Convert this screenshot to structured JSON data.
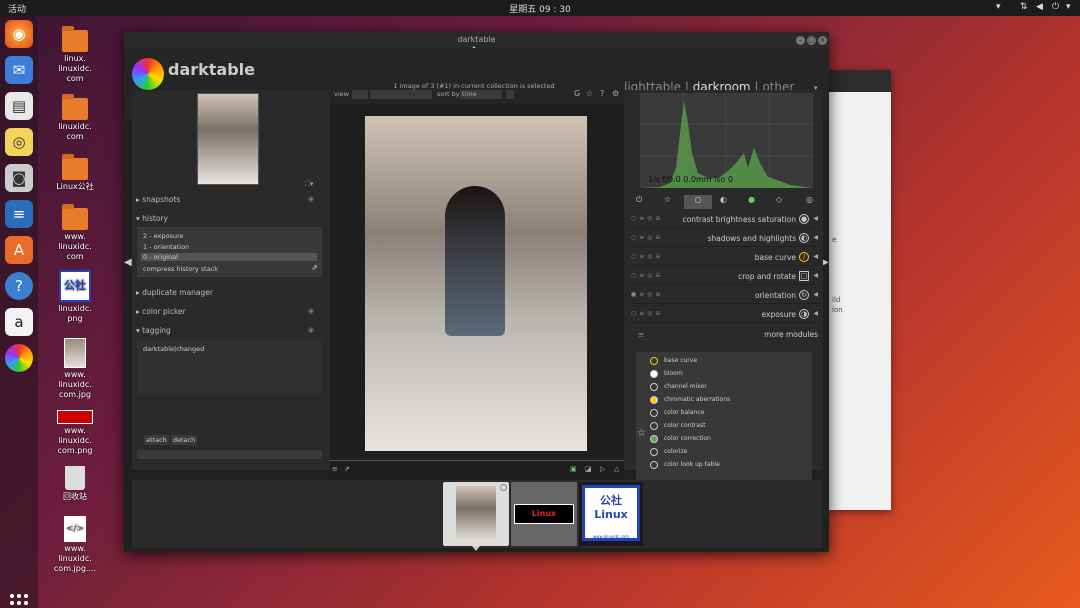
{
  "topbar": {
    "activities": "活动",
    "clock": "星期五 09 : 30"
  },
  "desktop": {
    "icons": [
      {
        "label": "linux.\nlinuxidc.\ncom"
      },
      {
        "label": "linuxidc.\ncom"
      },
      {
        "label": "Linux公社"
      },
      {
        "label": "www.\nlinuxidc.\ncom"
      },
      {
        "label": "linuxidc.\npng"
      },
      {
        "label": "www.\nlinuxidc.\ncom.jpg"
      },
      {
        "label": "www.\nlinuxidc.\ncom.png"
      },
      {
        "label": "回收站"
      },
      {
        "label": "www.\nlinuxidc.\ncom.jpg...."
      }
    ]
  },
  "gedit": {
    "texts": [
      "ild",
      "ion",
      "e"
    ]
  },
  "darktable": {
    "window_title": "darktable",
    "logo_name": "darktable",
    "status": "1 image of 3 (#1) in current collection is selected",
    "views": {
      "lighttable": "lighttable",
      "sep1": "|",
      "darkroom": "darkroom",
      "sep2": "|",
      "other": "other"
    },
    "toolbar": {
      "view": "view",
      "sort_by": "sort by",
      "sort_value": "time"
    },
    "left": {
      "snapshots": "snapshots",
      "history": "history",
      "history_items": [
        "2 - exposure",
        "1 - orientation",
        "0 - original"
      ],
      "compress": "compress history stack",
      "duplicate": "duplicate manager",
      "colorpicker": "color picker",
      "tagging": "tagging",
      "tag_value": "darktable|changed",
      "attach": "attach",
      "detach": "detach"
    },
    "histogram_info": "1/s f/0.0 0.0mm iso 0",
    "modules": [
      {
        "name": "contrast brightness saturation",
        "icon": "●"
      },
      {
        "name": "shadows and highlights",
        "icon": "◐"
      },
      {
        "name": "base curve",
        "icon": "∕"
      },
      {
        "name": "crop and rotate",
        "icon": "□"
      },
      {
        "name": "orientation",
        "icon": "↻"
      },
      {
        "name": "exposure",
        "icon": "◑"
      }
    ],
    "more_modules": "more modules",
    "module_list": [
      "base curve",
      "bloom",
      "channel mixer",
      "chromatic aberrations",
      "color balance",
      "color contrast",
      "color correction",
      "colorize",
      "color look up table"
    ]
  },
  "filmstrip": {
    "thumb2_text": "Linux",
    "thumb3_text": "公社\nLinux",
    "thumb3_url": "www.linuxidc.com"
  }
}
